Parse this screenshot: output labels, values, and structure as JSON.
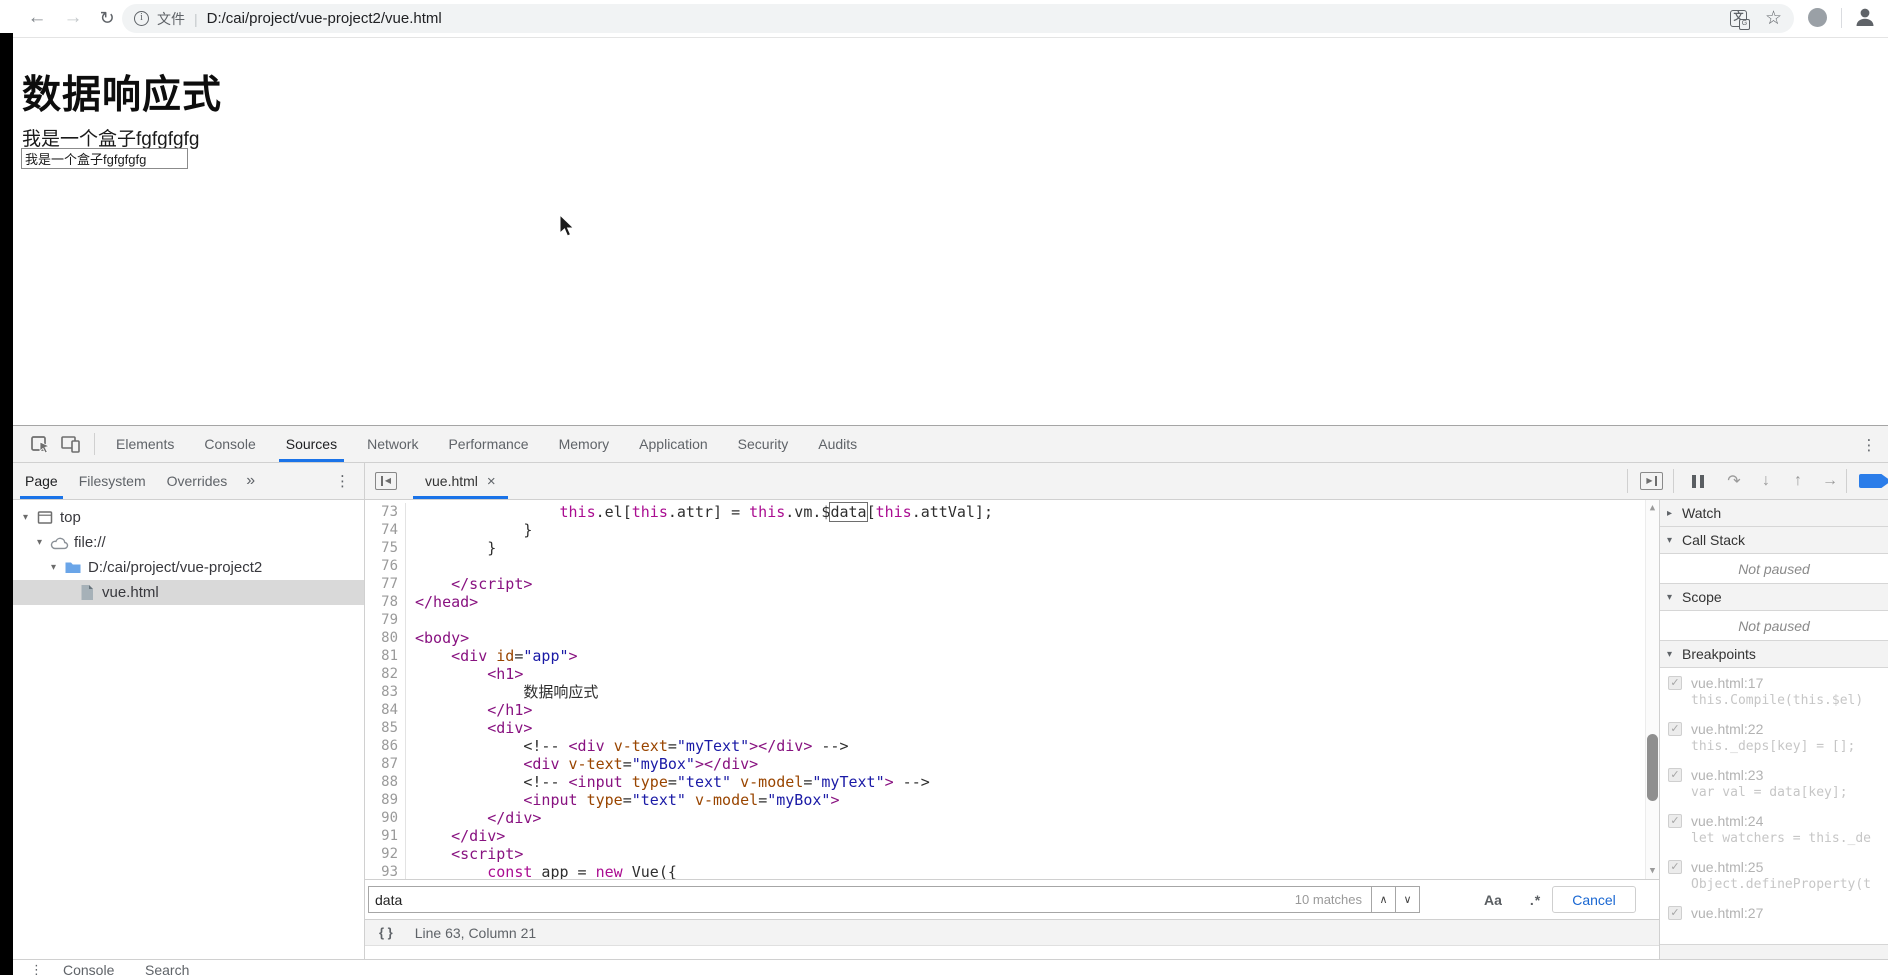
{
  "browser": {
    "back_icon": "←",
    "forward_icon": "→",
    "reload_icon": "↻",
    "info_icon": "i",
    "scheme_label": "文件",
    "url_divider": "|",
    "url": "D:/cai/project/vue-project2/vue.html",
    "translate_icon": "文",
    "translate_icon_badge": "G",
    "bookmark_star_icon": "☆"
  },
  "page": {
    "heading": "数据响应式",
    "box_text": "我是一个盒子fgfgfgfg",
    "input_value": "我是一个盒子fgfgfgfg"
  },
  "devtools": {
    "main_tabs": {
      "items": [
        "Elements",
        "Console",
        "Sources",
        "Network",
        "Performance",
        "Memory",
        "Application",
        "Security",
        "Audits"
      ],
      "selected": "Sources"
    },
    "menu_icon": "⋮",
    "sidebar": {
      "tabs": {
        "items": [
          "Page",
          "Filesystem",
          "Overrides"
        ],
        "selected": "Page"
      },
      "more_tabs_icon": "»",
      "menu_icon": "⋮",
      "tree": [
        {
          "label": "top",
          "icon": "frame-icon",
          "depth": 0,
          "arrow": "▾",
          "selected": false
        },
        {
          "label": "file://",
          "icon": "cloud-icon",
          "depth": 1,
          "arrow": "▾",
          "selected": false
        },
        {
          "label": "D:/cai/project/vue-project2",
          "icon": "folder-icon",
          "depth": 2,
          "arrow": "▾",
          "selected": false
        },
        {
          "label": "vue.html",
          "icon": "file-icon",
          "depth": 3,
          "arrow": "",
          "selected": true
        }
      ]
    },
    "editor": {
      "tab_label": "vue.html",
      "tab_close_icon": "×",
      "scroll_up_icon": "▲",
      "scroll_down_icon": "▼",
      "lines": [
        {
          "n": 73,
          "segs": [
            [
              "pln",
              "                "
            ],
            [
              "kwd",
              "this"
            ],
            [
              "pln",
              ".el["
            ],
            [
              "kwd",
              "this"
            ],
            [
              "pln",
              ".attr] = "
            ],
            [
              "kwd",
              "this"
            ],
            [
              "pln",
              ".vm.$"
            ],
            [
              "mtc",
              "data"
            ],
            [
              "pln",
              "["
            ],
            [
              "kwd",
              "this"
            ],
            [
              "pln",
              ".attVal];"
            ]
          ]
        },
        {
          "n": 74,
          "segs": [
            [
              "pln",
              "            }"
            ]
          ]
        },
        {
          "n": 75,
          "segs": [
            [
              "pln",
              "        }"
            ]
          ]
        },
        {
          "n": 76,
          "segs": []
        },
        {
          "n": 77,
          "segs": [
            [
              "pln",
              "    "
            ],
            [
              "tag",
              "</script>"
            ]
          ]
        },
        {
          "n": 78,
          "segs": [
            [
              "tag",
              "</head>"
            ]
          ]
        },
        {
          "n": 79,
          "segs": []
        },
        {
          "n": 80,
          "segs": [
            [
              "tag",
              "<body>"
            ]
          ]
        },
        {
          "n": 81,
          "segs": [
            [
              "pln",
              "    "
            ],
            [
              "tag",
              "<div"
            ],
            [
              "pln",
              " "
            ],
            [
              "atr",
              "id"
            ],
            [
              "pln",
              "="
            ],
            [
              "str",
              "\"app\""
            ],
            [
              "tag",
              ">"
            ]
          ]
        },
        {
          "n": 82,
          "segs": [
            [
              "pln",
              "        "
            ],
            [
              "tag",
              "<h1>"
            ]
          ]
        },
        {
          "n": 83,
          "segs": [
            [
              "pln",
              "            数据响应式"
            ]
          ]
        },
        {
          "n": 84,
          "segs": [
            [
              "pln",
              "        "
            ],
            [
              "tag",
              "</h1>"
            ]
          ]
        },
        {
          "n": 85,
          "segs": [
            [
              "pln",
              "        "
            ],
            [
              "tag",
              "<div>"
            ]
          ]
        },
        {
          "n": 86,
          "segs": [
            [
              "pln",
              "            <!-- "
            ],
            [
              "tag",
              "<div"
            ],
            [
              "pln",
              " "
            ],
            [
              "atr",
              "v-text"
            ],
            [
              "pln",
              "="
            ],
            [
              "str",
              "\"myText\""
            ],
            [
              "tag",
              "></div>"
            ],
            [
              "pln",
              " -->"
            ]
          ]
        },
        {
          "n": 87,
          "segs": [
            [
              "pln",
              "            "
            ],
            [
              "tag",
              "<div"
            ],
            [
              "pln",
              " "
            ],
            [
              "atr",
              "v-text"
            ],
            [
              "pln",
              "="
            ],
            [
              "str",
              "\"myBox\""
            ],
            [
              "tag",
              "></div>"
            ]
          ]
        },
        {
          "n": 88,
          "segs": [
            [
              "pln",
              "            <!-- "
            ],
            [
              "tag",
              "<input"
            ],
            [
              "pln",
              " "
            ],
            [
              "atr",
              "type"
            ],
            [
              "pln",
              "="
            ],
            [
              "str",
              "\"text\""
            ],
            [
              "pln",
              " "
            ],
            [
              "atr",
              "v-model"
            ],
            [
              "pln",
              "="
            ],
            [
              "str",
              "\"myText\""
            ],
            [
              "tag",
              ">"
            ],
            [
              "pln",
              " -->"
            ]
          ]
        },
        {
          "n": 89,
          "segs": [
            [
              "pln",
              "            "
            ],
            [
              "tag",
              "<input"
            ],
            [
              "pln",
              " "
            ],
            [
              "atr",
              "type"
            ],
            [
              "pln",
              "="
            ],
            [
              "str",
              "\"text\""
            ],
            [
              "pln",
              " "
            ],
            [
              "atr",
              "v-model"
            ],
            [
              "pln",
              "="
            ],
            [
              "str",
              "\"myBox\""
            ],
            [
              "tag",
              ">"
            ]
          ]
        },
        {
          "n": 90,
          "segs": [
            [
              "pln",
              "        "
            ],
            [
              "tag",
              "</div>"
            ]
          ]
        },
        {
          "n": 91,
          "segs": [
            [
              "pln",
              "    "
            ],
            [
              "tag",
              "</div>"
            ]
          ]
        },
        {
          "n": 92,
          "segs": [
            [
              "pln",
              "    "
            ],
            [
              "tag",
              "<script>"
            ]
          ]
        },
        {
          "n": 93,
          "segs": [
            [
              "pln",
              "        "
            ],
            [
              "kwd",
              "const"
            ],
            [
              "pln",
              " app = "
            ],
            [
              "kwd",
              "new"
            ],
            [
              "pln",
              " Vue({"
            ]
          ]
        }
      ]
    },
    "search": {
      "query": "data",
      "match_count": "10 matches",
      "prev_icon": "∧",
      "next_icon": "∨",
      "case_label": "Aa",
      "regex_label": ".*",
      "cancel_label": "Cancel"
    },
    "status": {
      "format_icon": "{ }",
      "position": "Line 63, Column 21"
    },
    "debugger": {
      "toolbar_icons": {
        "step_over": "↷",
        "step_into": "↓",
        "step_out": "↑",
        "step": "→"
      },
      "sections": [
        {
          "title": "Watch",
          "arrow": "▸"
        },
        {
          "title": "Call Stack",
          "arrow": "▾",
          "body": "Not paused"
        },
        {
          "title": "Scope",
          "arrow": "▾",
          "body": "Not paused"
        },
        {
          "title": "Breakpoints",
          "arrow": "▾"
        }
      ],
      "checkbox_icon": "✓",
      "breakpoints": [
        {
          "location": "vue.html:17",
          "code": "this.Compile(this.$el)"
        },
        {
          "location": "vue.html:22",
          "code": "this._deps[key] = [];"
        },
        {
          "location": "vue.html:23",
          "code": "var val = data[key];"
        },
        {
          "location": "vue.html:24",
          "code": "let watchers = this._de"
        },
        {
          "location": "vue.html:25",
          "code": "Object.defineProperty(t"
        },
        {
          "location": "vue.html:27",
          "code": ""
        }
      ]
    },
    "drawer": {
      "menu_icon": "⋮",
      "tabs": [
        "Console",
        "Search"
      ]
    }
  }
}
